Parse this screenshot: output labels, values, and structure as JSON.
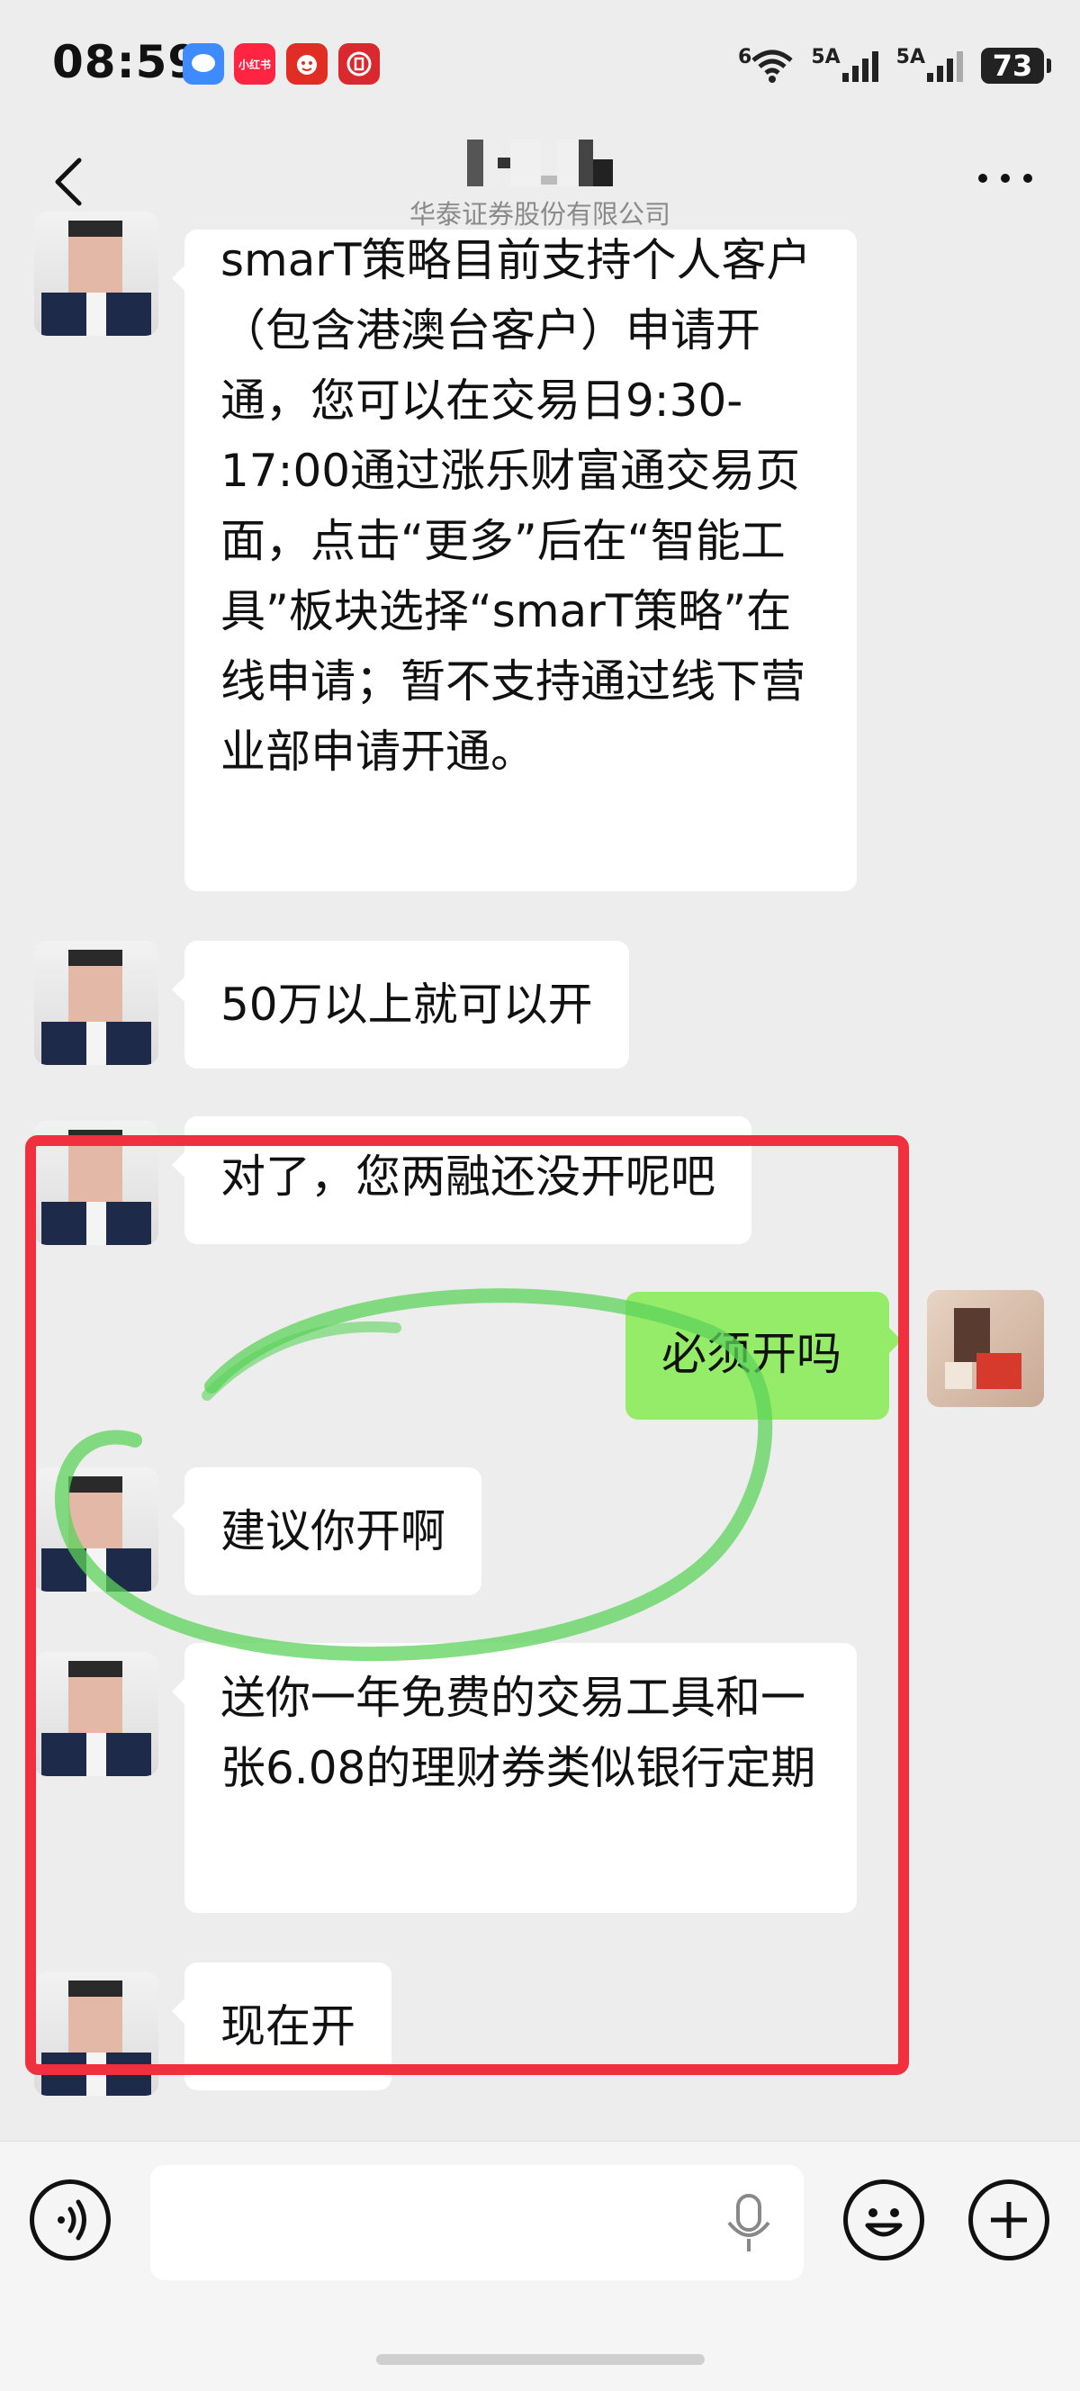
{
  "status_bar": {
    "time": "08:59",
    "app_icons": [
      {
        "name": "message-app-icon",
        "color": "#3d8bff"
      },
      {
        "name": "xiaohongshu-icon",
        "label": "小红书",
        "color": "#ff2442"
      },
      {
        "name": "pinduoduo-icon",
        "color": "#e02e24"
      },
      {
        "name": "unionpay-icon",
        "color": "#d9292f"
      }
    ],
    "wifi_label": "6",
    "signal_labels": [
      "5A",
      "5A"
    ],
    "battery": "73"
  },
  "header": {
    "subtitle": "华泰证券股份有限公司"
  },
  "messages": [
    {
      "side": "left",
      "text": "smarT策略目前支持个人客户（包含港澳台客户）申请开通，您可以在交易日9:30-17:00通过涨乐财富通交易页面，点击“更多”后在“智能工具”板块选择“smarT策略”在线申请；暂不支持通过线下营业部申请开通。"
    },
    {
      "side": "left",
      "text": "50万以上就可以开"
    },
    {
      "side": "left",
      "text": "对了，您两融还没开呢吧"
    },
    {
      "side": "right",
      "text": "必须开吗"
    },
    {
      "side": "left",
      "text": "建议你开啊"
    },
    {
      "side": "left",
      "text": "送你一年免费的交易工具和一张6.08的理财券类似银行定期"
    },
    {
      "side": "left",
      "text": "现在开"
    }
  ],
  "annotations": {
    "box_color": "#f0303e",
    "circle_color": "#5cd35a"
  },
  "input_bar": {
    "placeholder": ""
  }
}
